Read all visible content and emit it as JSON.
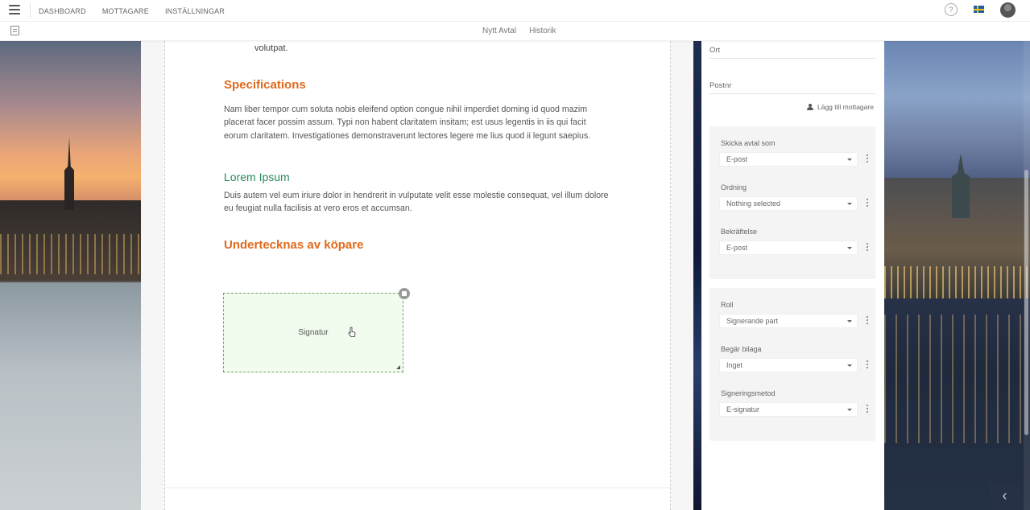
{
  "nav": {
    "items": [
      "DASHBOARD",
      "MOTTAGARE",
      "INSTÄLLNINGAR"
    ],
    "help": "?"
  },
  "subnav": {
    "items": [
      "Nytt Avtal",
      "Historik"
    ]
  },
  "document": {
    "prev_text": "volutpat.",
    "specifications": {
      "heading": "Specifications",
      "text": "Nam liber tempor cum soluta nobis eleifend option congue nihil imperdiet doming id quod mazim placerat facer possim assum. Typi non habent claritatem insitam; est usus legentis in iis qui facit eorum claritatem. Investigationes demonstraverunt lectores legere me lius quod ii legunt saepius."
    },
    "lorem": {
      "heading": "Lorem Ipsum",
      "text": "Duis autem vel eum iriure dolor in hendrerit in vulputate velit esse molestie consequat, vel illum dolore eu feugiat nulla facilisis at vero eros et accumsan."
    },
    "sign_heading": "Undertecknas av köpare",
    "signature_label": "Signatur"
  },
  "panel": {
    "ort": "Ort",
    "postnr": "Postnr",
    "add_recipient": "Lägg till mottagare",
    "group1": [
      {
        "label": "Skicka avtal som",
        "value": "E-post"
      },
      {
        "label": "Ordning",
        "value": "Nothing selected"
      },
      {
        "label": "Bekräftelse",
        "value": "E-post"
      }
    ],
    "group2": [
      {
        "label": "Roll",
        "value": "Signerande part"
      },
      {
        "label": "Begär bilaga",
        "value": "Inget"
      },
      {
        "label": "Signeringsmetod",
        "value": "E-signatur"
      }
    ]
  },
  "colors": {
    "heading_orange": "#e06a1d",
    "heading_green": "#2a8a5a",
    "signature_bg": "#f1fcef"
  },
  "icons": [
    "hamburger-icon",
    "document-icon",
    "help-icon",
    "swedish-flag-icon",
    "user-icon",
    "trash-icon",
    "resize-icon",
    "pointer-cursor-icon",
    "chevron-left-icon",
    "info-icon"
  ]
}
